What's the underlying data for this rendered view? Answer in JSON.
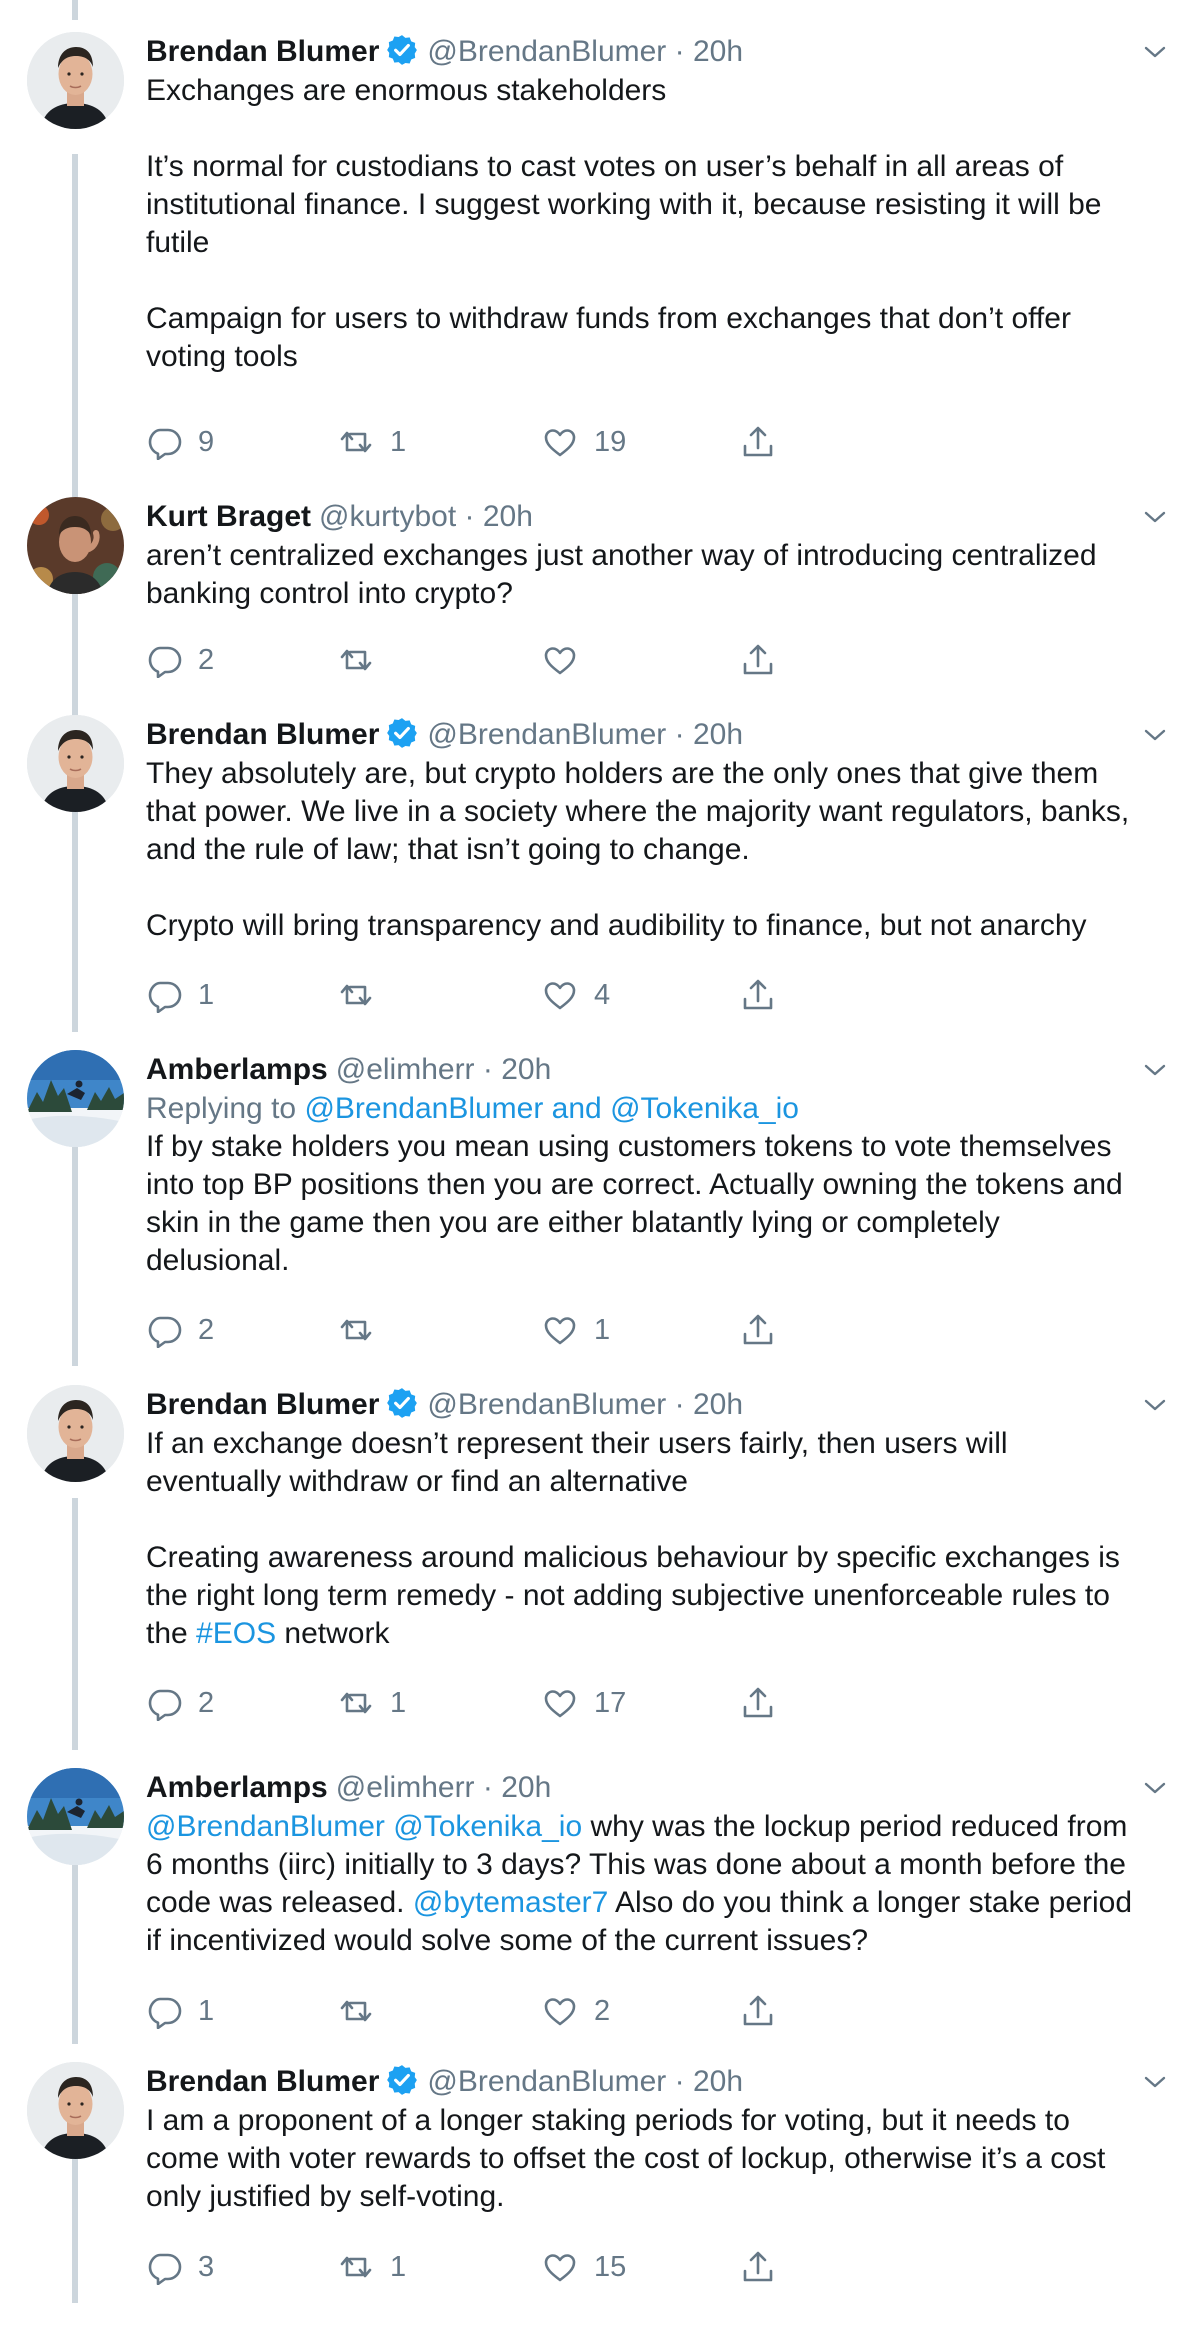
{
  "theme": {
    "text": "#14171a",
    "secondary": "#657786",
    "link": "#1b95e0",
    "verified": "#1da1f2",
    "thread_line": "#cdd6dd"
  },
  "tweets": [
    {
      "name": "Brendan Blumer",
      "verified": true,
      "handle": "@BrendanBlumer",
      "time": "20h",
      "avatar": "brendan-avatar",
      "reply_prefix": "",
      "reply_link": "",
      "text_parts": [
        "Exchanges are enormous stakeholders\n\nIt’s normal for custodians to cast votes on user’s behalf in all areas of\ninstitutional finance. I suggest working with it, because resisting it will be\nfutile\n\nCampaign for users to withdraw funds from exchanges that don’t offer\nvoting tools"
      ],
      "replies": "9",
      "retweets": "1",
      "likes": "19"
    },
    {
      "name": "Kurt Braget",
      "verified": false,
      "handle": "@kurtybot",
      "time": "20h",
      "avatar": "kurt-avatar",
      "reply_prefix": "",
      "reply_link": "",
      "text_parts": [
        "aren’t centralized exchanges just another way of introducing centralized\nbanking control into crypto?"
      ],
      "replies": "2",
      "retweets": "",
      "likes": ""
    },
    {
      "name": "Brendan Blumer",
      "verified": true,
      "handle": "@BrendanBlumer",
      "time": "20h",
      "avatar": "brendan-avatar",
      "reply_prefix": "",
      "reply_link": "",
      "text_parts": [
        "They absolutely are, but crypto holders are the only ones that give them\nthat power. We live in a society where the majority want regulators, banks,\nand the rule of law; that isn’t going to change.\n\nCrypto will bring transparency and audibility to finance, but not anarchy"
      ],
      "replies": "1",
      "retweets": "",
      "likes": "4"
    },
    {
      "name": "Amberlamps",
      "verified": false,
      "handle": "@elimherr",
      "time": "20h",
      "avatar": "amberlamps-avatar",
      "reply_prefix": "Replying to ",
      "reply_link": "@BrendanBlumer and @Tokenika_io",
      "text_parts": [
        "If by stake holders you mean using customers tokens to vote themselves\ninto top BP positions then you are correct. Actually owning the tokens and\nskin in the game then you are either blatantly lying or completely\ndelusional."
      ],
      "replies": "2",
      "retweets": "",
      "likes": "1"
    },
    {
      "name": "Brendan Blumer",
      "verified": true,
      "handle": "@BrendanBlumer",
      "time": "20h",
      "avatar": "brendan-avatar",
      "reply_prefix": "",
      "reply_link": "",
      "text_parts": [
        "If an exchange doesn’t represent their users fairly, then users will\neventually withdraw or find an alternative\n\nCreating awareness around malicious behaviour by specific exchanges is\nthe right long term remedy - not adding subjective unenforceable rules to\nthe ",
        "#EOS",
        " network"
      ],
      "replies": "2",
      "retweets": "1",
      "likes": "17"
    },
    {
      "name": "Amberlamps",
      "verified": false,
      "handle": "@elimherr",
      "time": "20h",
      "avatar": "amberlamps-avatar",
      "reply_prefix": "",
      "reply_link": "",
      "text_parts": [
        "",
        "@BrendanBlumer @Tokenika_io",
        " why was the lockup period reduced from\n6 months (iirc) initially to 3 days? This was done about a month before the\ncode was released. ",
        "@bytemaster7",
        " Also do you think a longer stake period\nif incentivized would solve some of the current issues?"
      ],
      "replies": "1",
      "retweets": "",
      "likes": "2"
    },
    {
      "name": "Brendan Blumer",
      "verified": true,
      "handle": "@BrendanBlumer",
      "time": "20h",
      "avatar": "brendan-avatar",
      "reply_prefix": "",
      "reply_link": "",
      "text_parts": [
        "I am a proponent of a longer staking periods for voting, but it needs to\ncome with voter rewards to offset the cost of lockup, otherwise it’s a cost\nonly justified by self-voting."
      ],
      "replies": "3",
      "retweets": "1",
      "likes": "15"
    }
  ]
}
